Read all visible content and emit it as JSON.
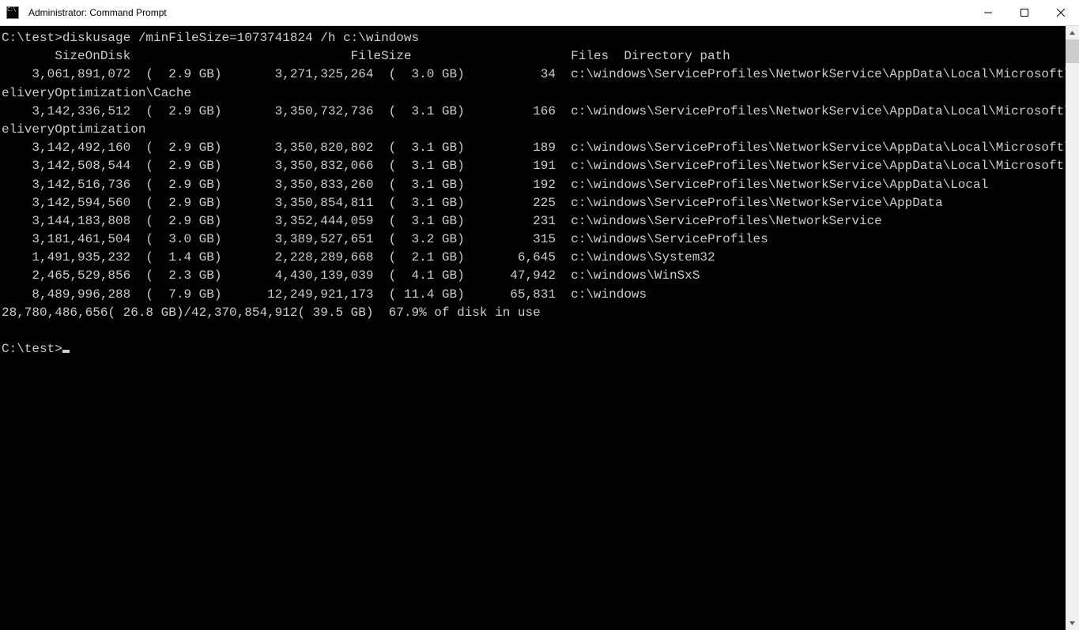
{
  "window": {
    "title": "Administrator: Command Prompt"
  },
  "prompt1": "C:\\test>",
  "command": "diskusage /minFileSize=1073741824 /h c:\\windows",
  "cols": {
    "sod": "SizeOnDisk",
    "fs": "FileSize",
    "files": "Files",
    "path": "Directory path"
  },
  "rows": [
    {
      "sod": "3,061,891,072",
      "sodh": "2.9 GB",
      "fs": "3,271,325,264",
      "fsh": "3.0 GB",
      "files": "34",
      "path": "c:\\windows\\ServiceProfiles\\NetworkService\\AppData\\Local\\Microsoft\\Windows\\DeliveryOptimization\\Cache"
    },
    {
      "sod": "3,142,336,512",
      "sodh": "2.9 GB",
      "fs": "3,350,732,736",
      "fsh": "3.1 GB",
      "files": "166",
      "path": "c:\\windows\\ServiceProfiles\\NetworkService\\AppData\\Local\\Microsoft\\Windows\\DeliveryOptimization"
    },
    {
      "sod": "3,142,492,160",
      "sodh": "2.9 GB",
      "fs": "3,350,820,802",
      "fsh": "3.1 GB",
      "files": "189",
      "path": "c:\\windows\\ServiceProfiles\\NetworkService\\AppData\\Local\\Microsoft\\Windows"
    },
    {
      "sod": "3,142,508,544",
      "sodh": "2.9 GB",
      "fs": "3,350,832,066",
      "fsh": "3.1 GB",
      "files": "191",
      "path": "c:\\windows\\ServiceProfiles\\NetworkService\\AppData\\Local\\Microsoft"
    },
    {
      "sod": "3,142,516,736",
      "sodh": "2.9 GB",
      "fs": "3,350,833,260",
      "fsh": "3.1 GB",
      "files": "192",
      "path": "c:\\windows\\ServiceProfiles\\NetworkService\\AppData\\Local"
    },
    {
      "sod": "3,142,594,560",
      "sodh": "2.9 GB",
      "fs": "3,350,854,811",
      "fsh": "3.1 GB",
      "files": "225",
      "path": "c:\\windows\\ServiceProfiles\\NetworkService\\AppData"
    },
    {
      "sod": "3,144,183,808",
      "sodh": "2.9 GB",
      "fs": "3,352,444,059",
      "fsh": "3.1 GB",
      "files": "231",
      "path": "c:\\windows\\ServiceProfiles\\NetworkService"
    },
    {
      "sod": "3,181,461,504",
      "sodh": "3.0 GB",
      "fs": "3,389,527,651",
      "fsh": "3.2 GB",
      "files": "315",
      "path": "c:\\windows\\ServiceProfiles"
    },
    {
      "sod": "1,491,935,232",
      "sodh": "1.4 GB",
      "fs": "2,228,289,668",
      "fsh": "2.1 GB",
      "files": "6,645",
      "path": "c:\\windows\\System32"
    },
    {
      "sod": "2,465,529,856",
      "sodh": "2.3 GB",
      "fs": "4,430,139,039",
      "fsh": "4.1 GB",
      "files": "47,942",
      "path": "c:\\windows\\WinSxS"
    },
    {
      "sod": "8,489,996,288",
      "sodh": "7.9 GB",
      "fs": "12,249,921,173",
      "fsh": "11.4 GB",
      "files": "65,831",
      "path": "c:\\windows"
    }
  ],
  "summary": {
    "sod_bytes": "28,780,486,656",
    "sod_h": "26.8 GB",
    "tot_bytes": "42,370,854,912",
    "tot_h": "39.5 GB",
    "pct": "67.9%",
    "suffix": "of disk in use"
  },
  "prompt2": "C:\\test>"
}
